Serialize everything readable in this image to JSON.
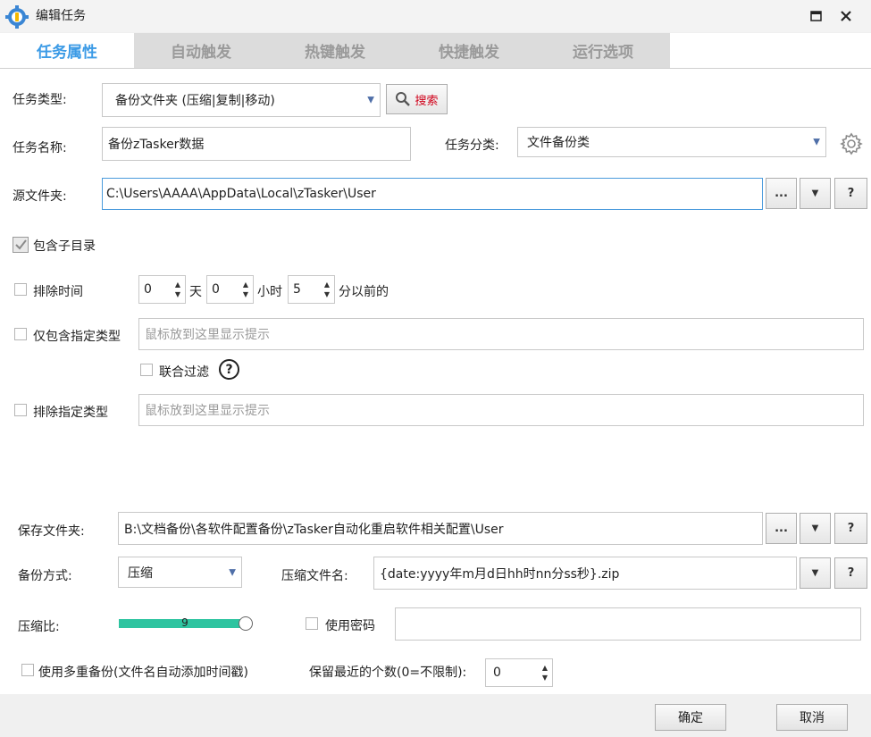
{
  "window": {
    "title": "编辑任务"
  },
  "tabs": [
    "任务属性",
    "自动触发",
    "热键触发",
    "快捷触发",
    "运行选项"
  ],
  "task": {
    "type_label": "任务类型:",
    "type_value": "备份文件夹 (压缩|复制|移动)",
    "search_label": "搜索",
    "name_label": "任务名称:",
    "name_value": "备份zTasker数据",
    "category_label": "任务分类:",
    "category_value": "文件备份类"
  },
  "source": {
    "label": "源文件夹:",
    "value": "C:\\Users\\AAAA\\AppData\\Local\\zTasker\\User",
    "browse": "...",
    "help": "?"
  },
  "subdir": {
    "label": "包含子目录",
    "checked": true
  },
  "exclude_time": {
    "label": "排除时间",
    "days": "0",
    "days_unit": "天",
    "hours": "0",
    "hours_unit": "小时",
    "minutes": "5",
    "minutes_unit": "分以前的"
  },
  "include_types": {
    "label": "仅包含指定类型",
    "placeholder": "鼠标放到这里显示提示"
  },
  "joint_filter": {
    "label": "联合过滤",
    "help": "?"
  },
  "exclude_types": {
    "label": "排除指定类型",
    "placeholder": "鼠标放到这里显示提示"
  },
  "save": {
    "label": "保存文件夹:",
    "value": "B:\\文档备份\\各软件配置备份\\zTasker自动化重启软件相关配置\\User",
    "browse": "...",
    "help": "?"
  },
  "backup_mode": {
    "label": "备份方式:",
    "value": "压缩"
  },
  "zip_name": {
    "label": "压缩文件名:",
    "value": "{date:yyyy年m月d日hh时nn分ss秒}.zip",
    "help": "?"
  },
  "compress_ratio": {
    "label": "压缩比:",
    "value": "9",
    "fraction": 1.0
  },
  "password": {
    "label": "使用密码",
    "value": ""
  },
  "multi_backup": {
    "label": "使用多重备份(文件名自动添加时间戳)"
  },
  "keep_recent": {
    "label": "保留最近的个数(0=不限制):",
    "value": "0"
  },
  "footer": {
    "ok": "确定",
    "cancel": "取消"
  },
  "colors": {
    "accent": "#3c9be6",
    "slider": "#2ec4a0",
    "search_text": "#d0021b"
  }
}
